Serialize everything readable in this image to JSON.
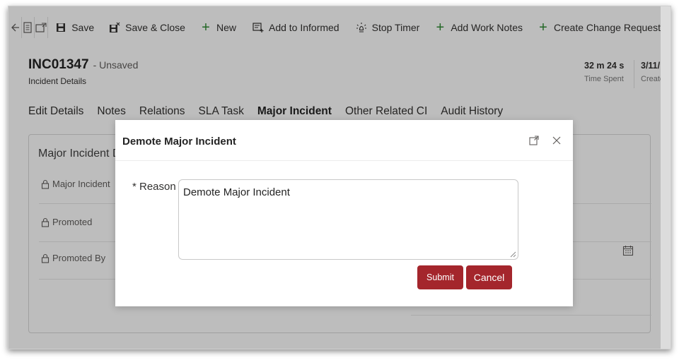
{
  "toolbar": {
    "save_label": "Save",
    "save_close_label": "Save & Close",
    "new_label": "New",
    "add_informed_label": "Add to Informed",
    "stop_timer_label": "Stop Timer",
    "add_work_notes_label": "Add Work Notes",
    "create_change_label": "Create Change Request"
  },
  "header": {
    "title": "INC01347",
    "status": "- Unsaved",
    "subtitle": "Incident Details",
    "time_spent_value": "32 m 24 s",
    "time_spent_label": "Time Spent",
    "created_value": "3/11/",
    "created_label": "Create"
  },
  "tabs": [
    {
      "label": "Edit Details"
    },
    {
      "label": "Notes"
    },
    {
      "label": "Relations"
    },
    {
      "label": "SLA Task"
    },
    {
      "label": "Major Incident"
    },
    {
      "label": "Other Related CI"
    },
    {
      "label": "Audit History"
    }
  ],
  "section": {
    "title": "Major Incident D",
    "fields": [
      {
        "label": "Major Incident"
      },
      {
        "label": "Promoted"
      },
      {
        "label": "Promoted By"
      }
    ]
  },
  "dialog": {
    "title": "Demote Major Incident",
    "reason_label": "* Reason",
    "reason_value": "Demote Major Incident",
    "submit_label": "Submit",
    "cancel_label": "Cancel"
  },
  "colors": {
    "accent": "#a4262c",
    "new_plus": "#2e8b32"
  }
}
